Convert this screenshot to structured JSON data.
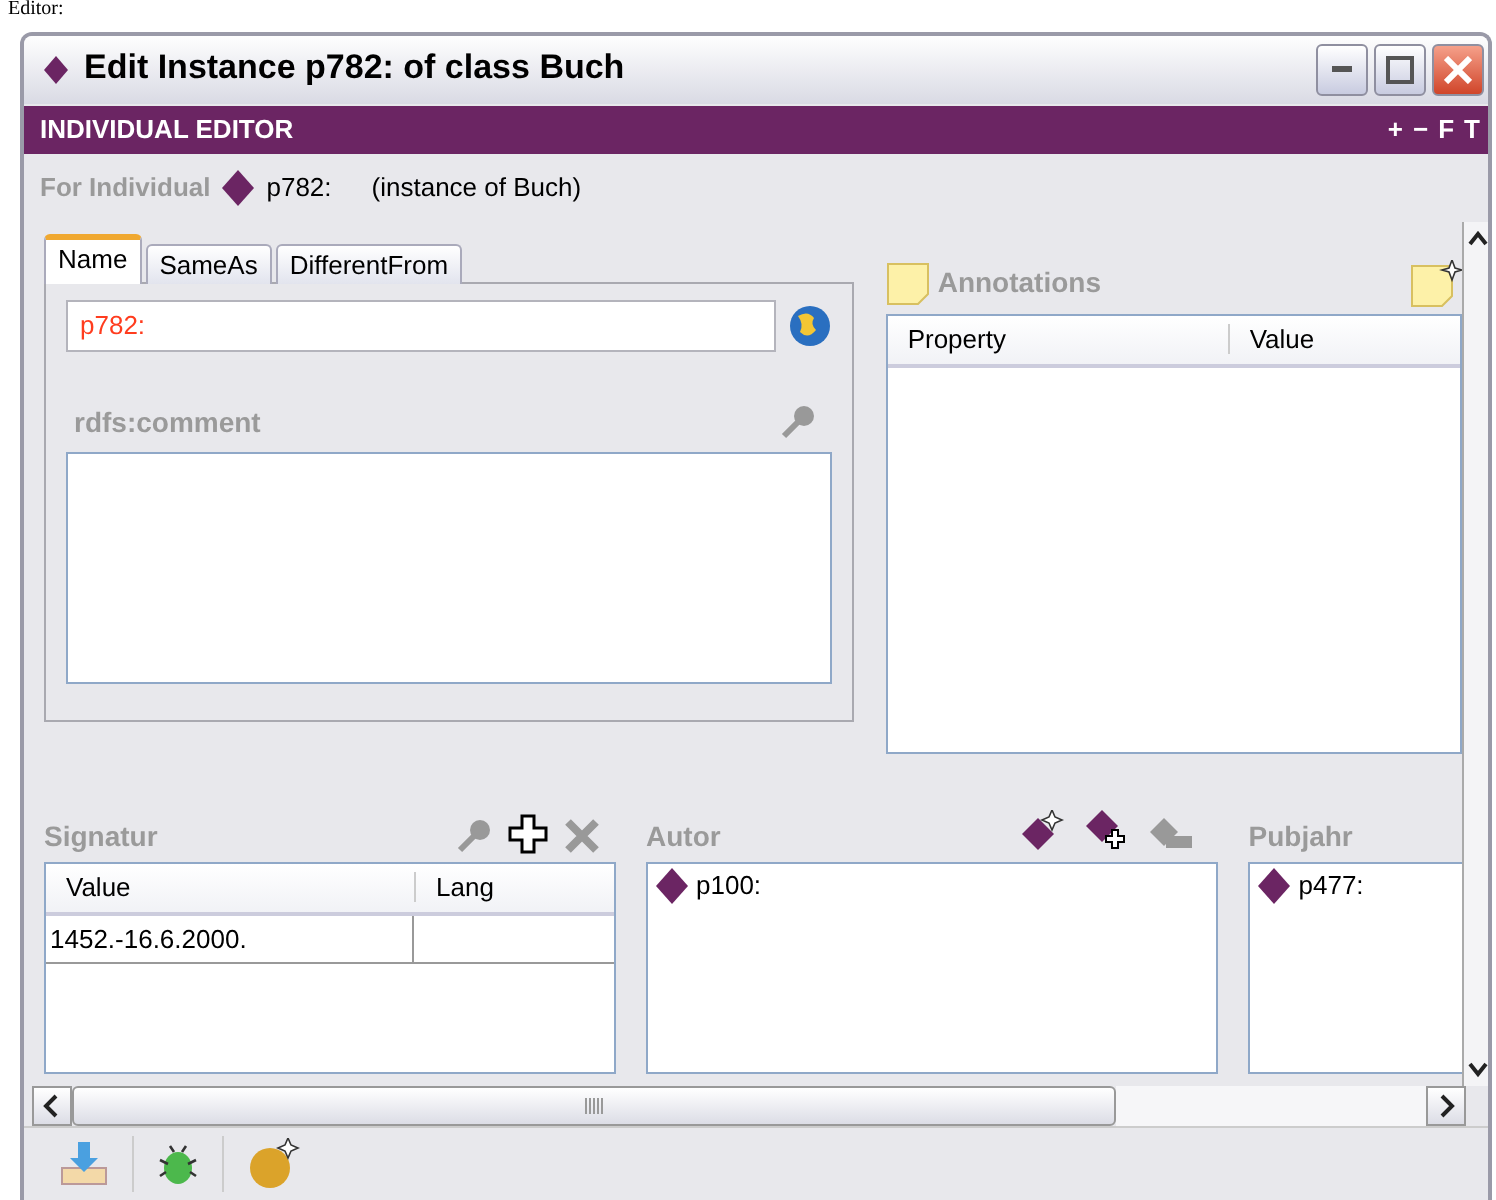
{
  "caption": "Editor:",
  "window": {
    "title": "Edit Instance p782: of class Buch"
  },
  "header": {
    "title": "INDIVIDUAL EDITOR",
    "tools": [
      "+",
      "−",
      "F",
      "T"
    ]
  },
  "for_individual": {
    "label": "For Individual",
    "name": "p782:",
    "type": "(instance of Buch)"
  },
  "tabs": [
    {
      "label": "Name",
      "selected": true
    },
    {
      "label": "SameAs",
      "selected": false
    },
    {
      "label": "DifferentFrom",
      "selected": false
    }
  ],
  "name_field": {
    "value": "p782:"
  },
  "comment": {
    "label": "rdfs:comment"
  },
  "annotations": {
    "title": "Annotations",
    "columns": [
      "Property",
      "Value"
    ]
  },
  "signatur": {
    "label": "Signatur",
    "columns": [
      "Value",
      "Lang"
    ],
    "rows": [
      {
        "value": "1452.-16.6.2000."
      }
    ]
  },
  "autor": {
    "label": "Autor",
    "items": [
      "p100:"
    ]
  },
  "pubjahr": {
    "label": "Pubjahr",
    "items": [
      "p477:"
    ]
  }
}
